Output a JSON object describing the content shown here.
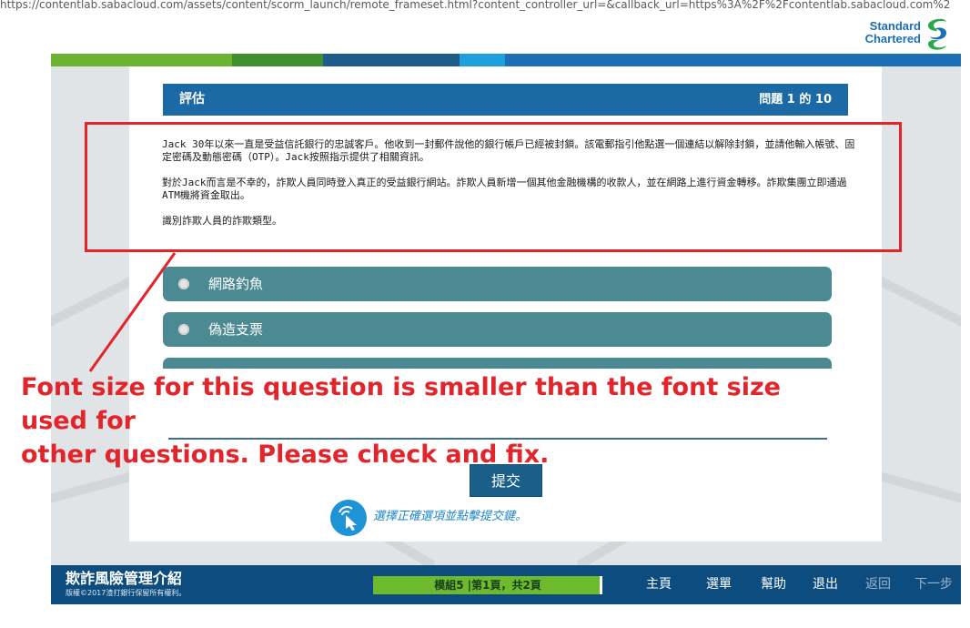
{
  "browser": {
    "url": "https://contentlab.sabacloud.com/assets/content/scorm_launch/remote_frameset.html?content_controller_url=&callback_url=https%3A%2F%2Fcontentlab.sabacloud.com%2"
  },
  "brand": {
    "line1": "Standard",
    "line2": "Chartered",
    "colors": {
      "blue": "#1c6fb5",
      "green": "#2aa84a"
    }
  },
  "stripe_colors": [
    "#6cb332",
    "#3f8e2f",
    "#1e5c8a",
    "#1ea0df",
    "#1c6fb5"
  ],
  "question": {
    "title": "評估",
    "counter": "問題  1  的 10",
    "paragraphs": [
      "Jack 30年以來一直是受益信託銀行的忠誠客戶。他收到一封郵件說他的銀行帳戶已經被封鎖。該電郵指引他點選一個連結以解除封鎖，並請他輸入帳號、固定密碼及動態密碼（OTP）。Jack按照指示提供了相關資訊。",
      "對於Jack而言是不幸的，詐欺人員同時登入真正的受益銀行網站。詐欺人員新增一個其他金融機構的收款人，並在網路上進行資金轉移。詐欺集團立即通過ATM機將資金取出。",
      "識別詐欺人員的詐欺類型。"
    ],
    "options": [
      {
        "label": "網路釣魚"
      },
      {
        "label": "偽造支票"
      }
    ]
  },
  "annotation": {
    "line1": "Font size for this question is smaller than the font size used for",
    "line2": "other questions. Please check and fix.",
    "color": "#e2252b"
  },
  "actions": {
    "submit_label": "提交",
    "hint": "選擇正確選項並點擊提交鍵。"
  },
  "footer": {
    "course_title": "欺詐風險管理介紹",
    "copyright": "版權©2017渣打銀行保留所有權利。",
    "progress_label": "模組5 |第1頁，共2頁",
    "nav": {
      "home": "主頁",
      "menu": "選單",
      "help": "幫助",
      "exit": "退出",
      "back": "返回",
      "next": "下一步"
    }
  }
}
